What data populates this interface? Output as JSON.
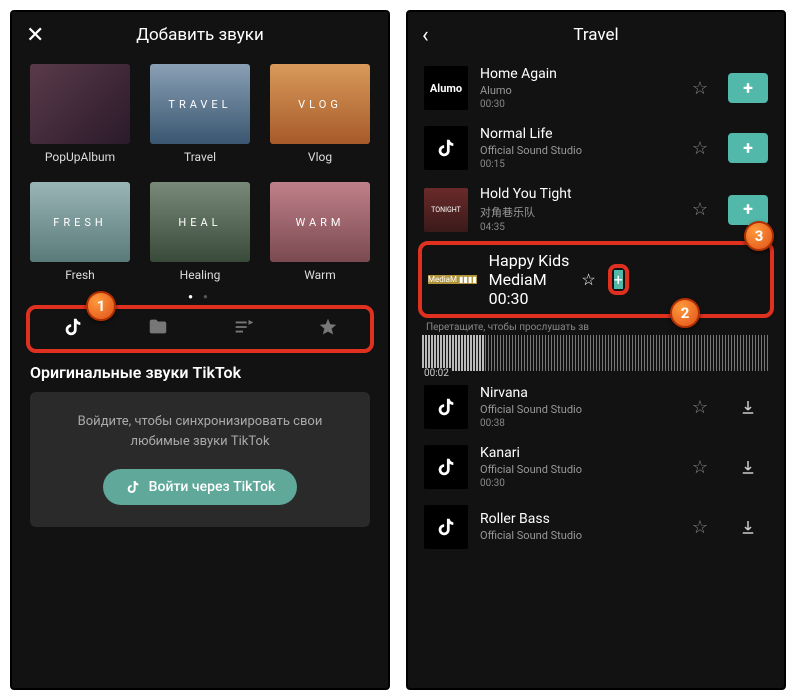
{
  "left": {
    "title": "Добавить звуки",
    "categories": [
      {
        "label": "PopUpAlbum",
        "text": "",
        "cls": "t-popup"
      },
      {
        "label": "Travel",
        "text": "TRAVEL",
        "cls": "t-travel"
      },
      {
        "label": "Vlog",
        "text": "VLOG",
        "cls": "t-vlog"
      },
      {
        "label": "Fresh",
        "text": "FRESH",
        "cls": "t-fresh"
      },
      {
        "label": "Healing",
        "text": "HEAL",
        "cls": "t-heal"
      },
      {
        "label": "Warm",
        "text": "WARM",
        "cls": "t-warm"
      }
    ],
    "section": "Оригинальные звуки TikTok",
    "login_hint": "Войдите, чтобы синхронизировать свои любимые звуки TikTok",
    "login_btn": "Войти через TikTok",
    "badge1": "1"
  },
  "right": {
    "title": "Travel",
    "tracks": [
      {
        "title": "Home Again",
        "artist": "Alumo",
        "dur": "00:30",
        "art": "alumo",
        "art_text": "Alumo",
        "act": "add"
      },
      {
        "title": "Normal Life",
        "artist": "Official Sound Studio",
        "dur": "00:15",
        "art": "tt",
        "art_text": "",
        "act": "add"
      },
      {
        "title": "Hold You Tight",
        "artist": "对角巷乐队",
        "dur": "04:35",
        "art": "tonight",
        "art_text": "TONIGHT",
        "act": "add"
      }
    ],
    "selected": {
      "title": "Happy Kids",
      "artist": "MediaM",
      "dur": "00:30",
      "art_text": "MediaM"
    },
    "wave_hint": "Перетащите, чтобы прослушать зв",
    "wave_time": "00:02",
    "tracks2": [
      {
        "title": "Nirvana",
        "artist": "Official Sound Studio",
        "dur": "00:38",
        "art": "tt",
        "act": "dl"
      },
      {
        "title": "Kanari",
        "artist": "Official Sound Studio",
        "dur": "00:30",
        "art": "tt",
        "act": "dl"
      },
      {
        "title": "Roller Bass",
        "artist": "Official Sound Studio",
        "dur": "",
        "art": "tt",
        "act": "dl"
      }
    ],
    "badge2": "2",
    "badge3": "3"
  }
}
